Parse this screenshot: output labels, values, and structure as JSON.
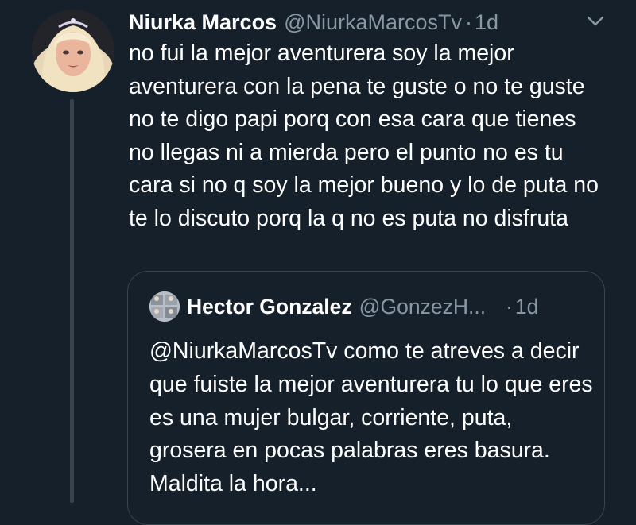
{
  "tweet": {
    "author_name": "Niurka Marcos",
    "author_handle": "@NiurkaMarcosTv",
    "separator": "·",
    "time": "1d",
    "text": "no fui la mejor aventurera soy la mejor aventurera con la pena te guste o no te guste no te digo papi porq con esa cara que tienes no llegas ni a mierda pero el punto no es tu cara si no q soy la mejor bueno y lo de puta no te lo discuto porq la q no es puta no disfruta"
  },
  "quoted_tweet": {
    "author_name": "Hector Gonzalez",
    "author_handle": "@GonzezH...",
    "separator": "·",
    "time": "1d",
    "text": "@NiurkaMarcosTv como te atreves a decir que fuiste la mejor aventurera tu lo que eres es una mujer bulgar, corriente, puta, grosera en pocas palabras eres basura. Maldita la hora..."
  },
  "icons": {
    "menu": "chevron-down-icon",
    "avatar": "avatar",
    "quoted_avatar": "avatar"
  },
  "colors": {
    "background": "#15202b",
    "primary_text": "#ffffff",
    "secondary_text": "#8899a6",
    "border": "#38444d"
  }
}
